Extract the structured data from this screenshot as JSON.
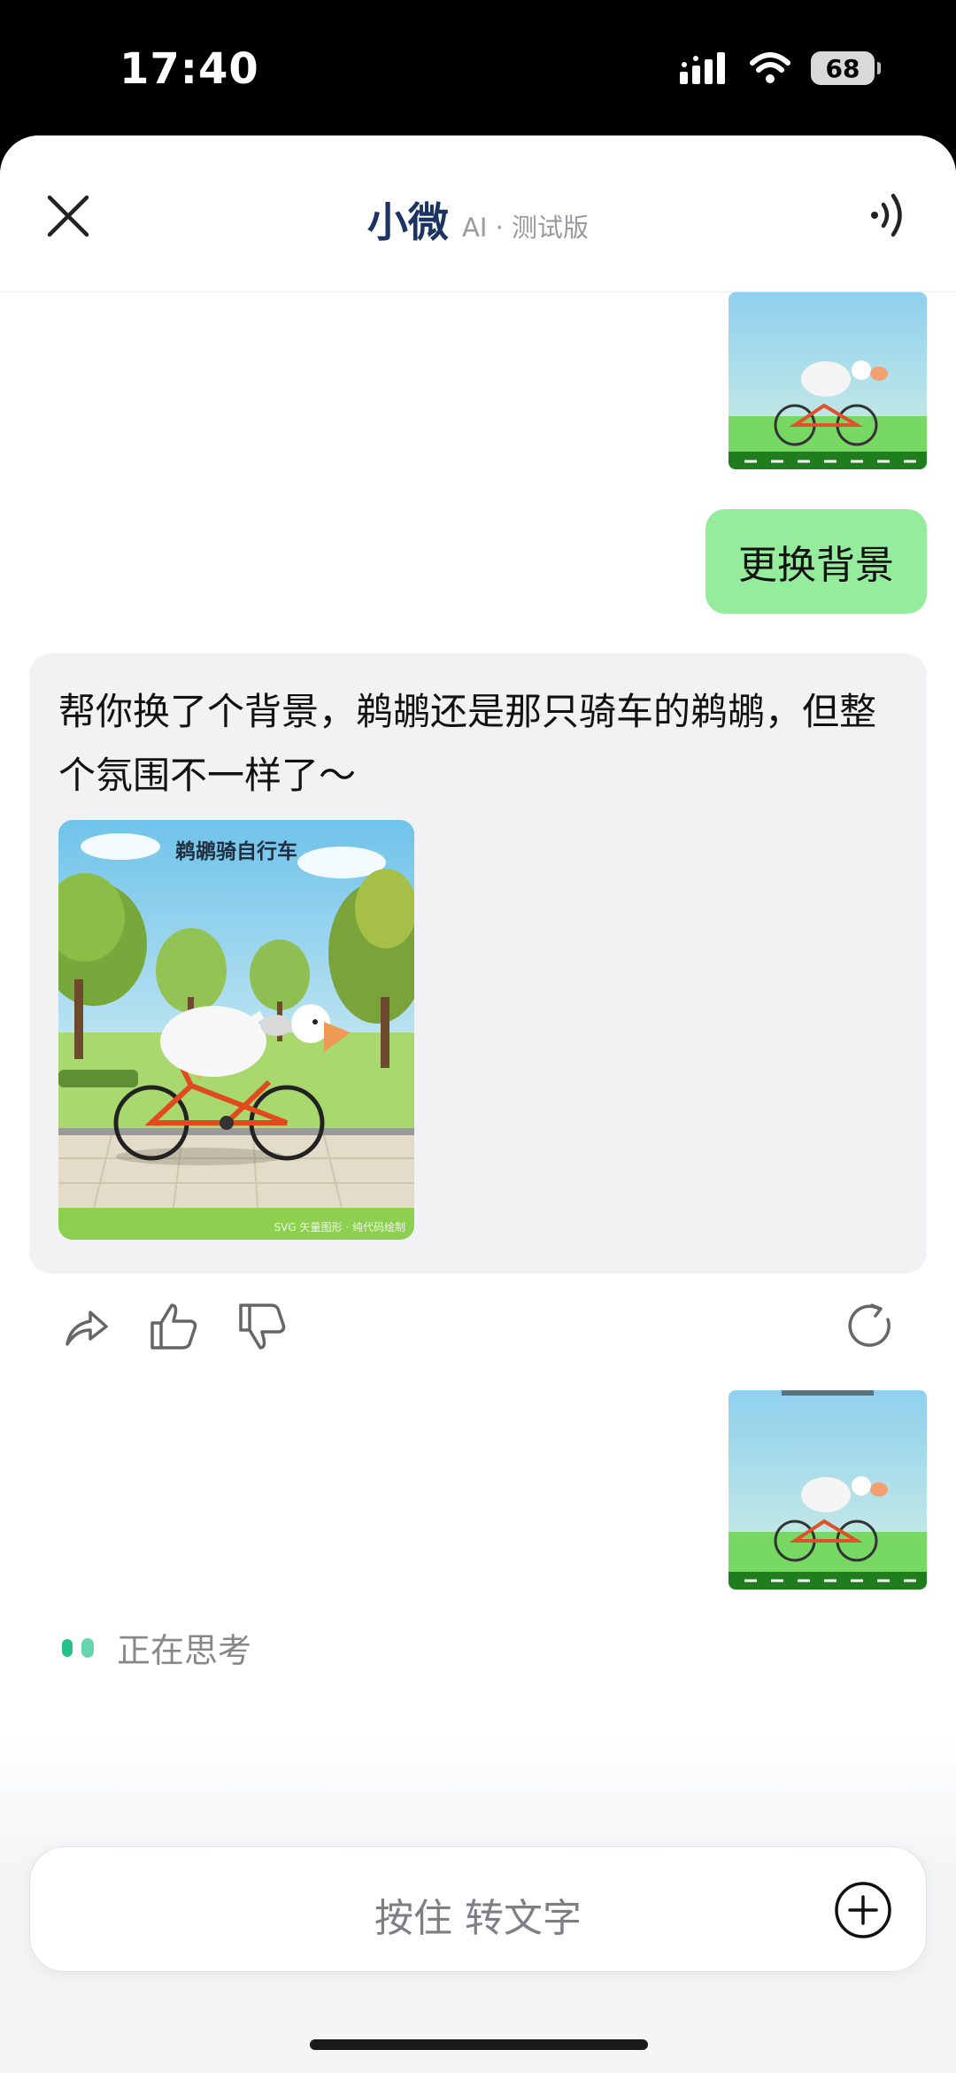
{
  "status_bar": {
    "time": "17:40",
    "battery": "68",
    "icons": [
      "signal-icon",
      "wifi-icon",
      "battery-icon"
    ]
  },
  "header": {
    "title": "小微",
    "subtitle": "AI · 测试版",
    "close_icon": "close-icon",
    "speaker_icon": "speaker-icon"
  },
  "messages": {
    "user_text": "更换背景",
    "ai_text": "帮你换了个背景，鹈鹕还是那只骑车的鹈鹕，但整个氛围不一样了～",
    "ai_image": {
      "title": "鹈鹕骑自行车",
      "credit": "SVG 矢量图形 · 纯代码绘制"
    }
  },
  "action_bar": {
    "icons": [
      "share-icon",
      "thumbs-up-icon",
      "thumbs-down-icon",
      "refresh-icon"
    ]
  },
  "thinking": {
    "label": "正在思考"
  },
  "input": {
    "label": "按住 转文字",
    "plus_icon": "plus-icon"
  },
  "colors": {
    "user_bubble": "#95ec9c",
    "ai_card": "#f2f2f4",
    "title": "#1c3461",
    "thinking_dot": "#25c28a"
  }
}
